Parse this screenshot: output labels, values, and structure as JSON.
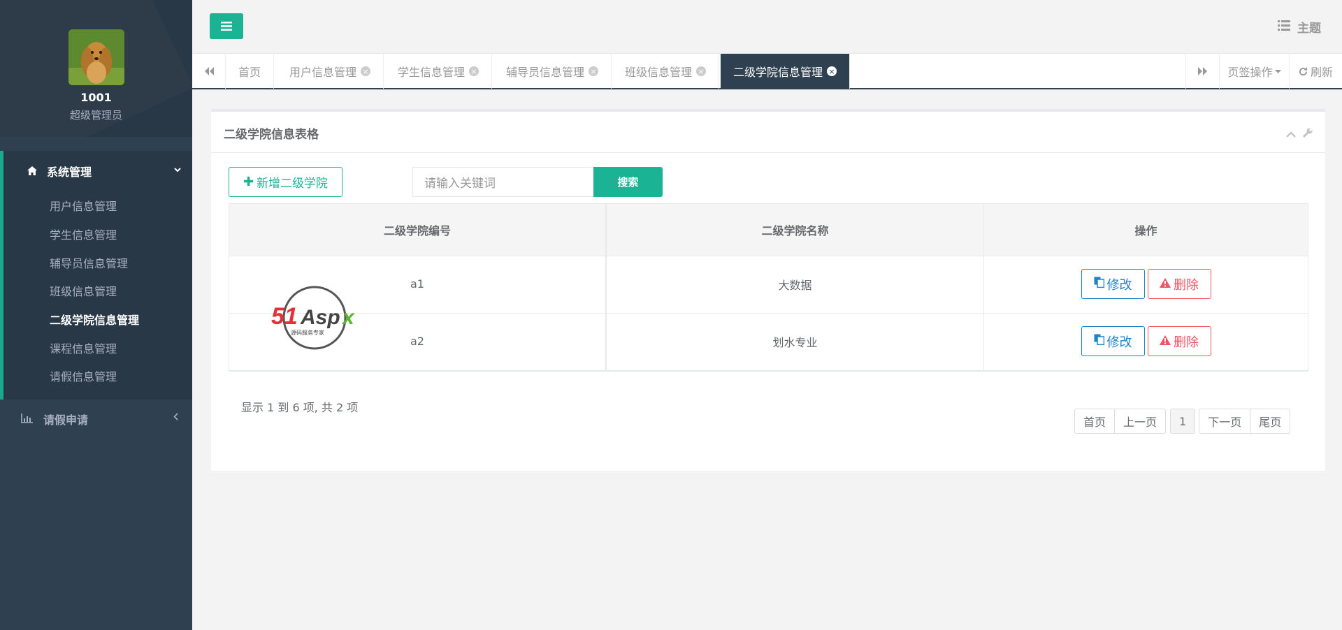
{
  "profile": {
    "name": "1001",
    "role": "超级管理员"
  },
  "sidebar": {
    "group1": {
      "label": "系统管理",
      "items": [
        "用户信息管理",
        "学生信息管理",
        "辅导员信息管理",
        "班级信息管理",
        "二级学院信息管理",
        "课程信息管理",
        "请假信息管理"
      ],
      "active_index": 4
    },
    "group2": {
      "label": "请假申请"
    }
  },
  "header": {
    "theme_label": "主题"
  },
  "tabs": {
    "items": [
      "首页",
      "用户信息管理",
      "学生信息管理",
      "辅导员信息管理",
      "班级信息管理",
      "二级学院信息管理"
    ],
    "active_index": 5,
    "ops_label": "页签操作",
    "refresh_label": "刷新"
  },
  "panel": {
    "title": "二级学院信息表格",
    "add_label": "新增二级学院",
    "search_placeholder": "请输入关键词",
    "search_label": "搜索",
    "columns": [
      "二级学院编号",
      "二级学院名称",
      "操作"
    ],
    "rows": [
      {
        "id": "a1",
        "name": "大数据"
      },
      {
        "id": "a2",
        "name": "划水专业"
      }
    ],
    "edit_label": "修改",
    "delete_label": "删除",
    "summary": "显示 1 到 6 项, 共 2 项",
    "pager": {
      "first": "首页",
      "prev": "上一页",
      "current": "1",
      "next": "下一页",
      "last": "尾页"
    }
  },
  "watermark": {
    "text": "51Aspx",
    "tagline": "源码服务专家"
  },
  "colors": {
    "primary": "#1ab394",
    "sidebar": "#2f4050",
    "info": "#1c84c6",
    "danger": "#ed5565"
  }
}
